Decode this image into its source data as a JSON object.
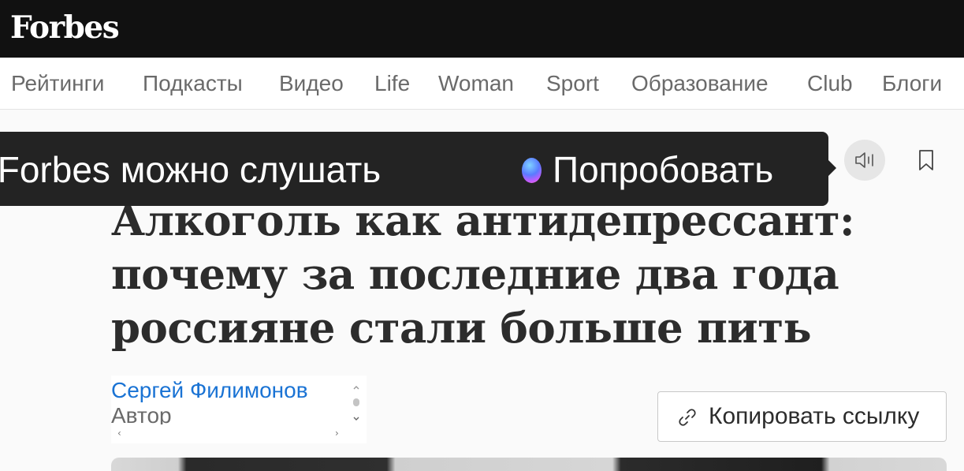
{
  "header": {
    "logo_text": "Forbes"
  },
  "nav": {
    "items": [
      {
        "label": "Рейтинги"
      },
      {
        "label": "Подкасты"
      },
      {
        "label": "Видео"
      },
      {
        "label": "Life"
      },
      {
        "label": "Woman"
      },
      {
        "label": "Sport"
      },
      {
        "label": "Образование"
      },
      {
        "label": "Club"
      },
      {
        "label": "Блоги"
      }
    ]
  },
  "tooltip": {
    "text": "ь Forbes можно слушать",
    "cta": "Попробовать"
  },
  "article": {
    "headline_lines": [
      "Алкоголь как антидепрессант:",
      "почему за последние два года",
      "россияне стали больше пить"
    ],
    "author": {
      "name": "Сергей Филимонов",
      "role": "Автор"
    },
    "copy_link_label": "Копировать ссылку"
  },
  "colors": {
    "topbar": "#111111",
    "author_link": "#1a73d4",
    "tooltip_bg": "#232323"
  },
  "icons": {
    "audio": "audio-play-icon",
    "bookmark": "bookmark-icon",
    "link": "link-icon",
    "orb": "ai-orb-icon"
  }
}
